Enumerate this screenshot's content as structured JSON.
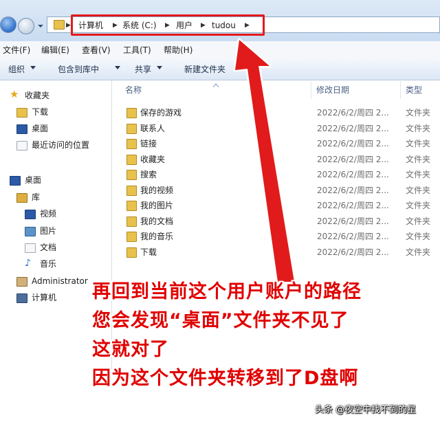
{
  "address_bar": {
    "crumbs": [
      "计算机",
      "系统 (C:)",
      "用户",
      "tudou"
    ]
  },
  "menu": [
    "文件(F)",
    "编辑(E)",
    "查看(V)",
    "工具(T)",
    "帮助(H)"
  ],
  "toolbar": {
    "organize": "组织",
    "include_in_library": "包含到库中",
    "share": "共享",
    "new_folder": "新建文件夹"
  },
  "nav": {
    "favorites": "收藏夹",
    "downloads": "下载",
    "desktop_fav": "桌面",
    "recent": "最近访问的位置",
    "desktop": "桌面",
    "libraries": "库",
    "videos": "视频",
    "pictures": "图片",
    "documents": "文档",
    "music": "音乐",
    "administrator": "Administrator",
    "computer": "计算机"
  },
  "columns": {
    "name": "名称",
    "modified": "修改日期",
    "type": "类型"
  },
  "files": [
    {
      "name": "保存的游戏",
      "date": "2022/6/2/周四 2...",
      "type": "文件夹"
    },
    {
      "name": "联系人",
      "date": "2022/6/2/周四 2...",
      "type": "文件夹"
    },
    {
      "name": "链接",
      "date": "2022/6/2/周四 2...",
      "type": "文件夹"
    },
    {
      "name": "收藏夹",
      "date": "2022/6/2/周四 2...",
      "type": "文件夹"
    },
    {
      "name": "搜索",
      "date": "2022/6/2/周四 2...",
      "type": "文件夹"
    },
    {
      "name": "我的视频",
      "date": "2022/6/2/周四 2...",
      "type": "文件夹"
    },
    {
      "name": "我的图片",
      "date": "2022/6/2/周四 2...",
      "type": "文件夹"
    },
    {
      "name": "我的文档",
      "date": "2022/6/2/周四 2...",
      "type": "文件夹"
    },
    {
      "name": "我的音乐",
      "date": "2022/6/2/周四 2...",
      "type": "文件夹"
    },
    {
      "name": "下载",
      "date": "2022/6/2/周四 2...",
      "type": "文件夹"
    }
  ],
  "annotation": {
    "line1": "再回到当前这个用户账户的路径",
    "line2": "您会发现“桌面”文件夹不见了",
    "line3": "这就对了",
    "line4": "因为这个文件夹转移到了D盘啊"
  },
  "watermark": "头条 @夜空中找不到的星",
  "colors": {
    "annotation_red": "#e00000",
    "highlight_box": "#e51919"
  }
}
